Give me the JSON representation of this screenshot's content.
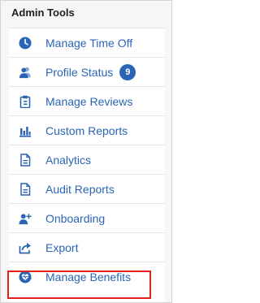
{
  "panel": {
    "title": "Admin Tools"
  },
  "menu": {
    "items": [
      {
        "label": "Manage Time Off",
        "icon": "clock-icon"
      },
      {
        "label": "Profile Status",
        "icon": "people-icon",
        "badge": "9"
      },
      {
        "label": "Manage Reviews",
        "icon": "clipboard-icon"
      },
      {
        "label": "Custom Reports",
        "icon": "bar-chart-icon"
      },
      {
        "label": "Analytics",
        "icon": "document-icon"
      },
      {
        "label": "Audit Reports",
        "icon": "document-icon"
      },
      {
        "label": "Onboarding",
        "icon": "add-user-icon"
      },
      {
        "label": "Export",
        "icon": "export-icon"
      },
      {
        "label": "Manage Benefits",
        "icon": "heart-badge-icon"
      }
    ]
  },
  "colors": {
    "link": "#2c64b5",
    "highlight": "#e0231b"
  }
}
